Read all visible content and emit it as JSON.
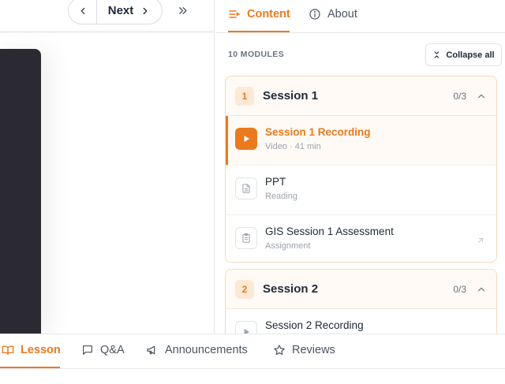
{
  "nav": {
    "next_label": "Next"
  },
  "sidebar": {
    "tabs": [
      {
        "label": "Content",
        "active": true
      },
      {
        "label": "About",
        "active": false
      }
    ],
    "modules_count": "10 MODULES",
    "collapse_label": "Collapse all",
    "sessions": [
      {
        "number": "1",
        "title": "Session 1",
        "progress": "0/3",
        "items": [
          {
            "title": "Session 1 Recording",
            "subtitle": "Video · 41 min",
            "icon": "play-icon",
            "active": true
          },
          {
            "title": "PPT",
            "subtitle": "Reading",
            "icon": "document-icon",
            "active": false
          },
          {
            "title": "GIS Session 1 Assessment",
            "subtitle": "Assignment",
            "icon": "clipboard-icon",
            "active": false
          }
        ]
      },
      {
        "number": "2",
        "title": "Session 2",
        "progress": "0/3",
        "items": [
          {
            "title": "Session 2 Recording",
            "subtitle": "",
            "icon": "play-icon",
            "active": false
          }
        ]
      }
    ]
  },
  "bottom_tabs": [
    {
      "label": "Lesson",
      "active": true
    },
    {
      "label": "Q&A",
      "active": false
    },
    {
      "label": "Announcements",
      "active": false
    },
    {
      "label": "Reviews",
      "active": false
    }
  ],
  "colors": {
    "accent": "#ea7a1e",
    "video_bg": "#2b2a33"
  }
}
